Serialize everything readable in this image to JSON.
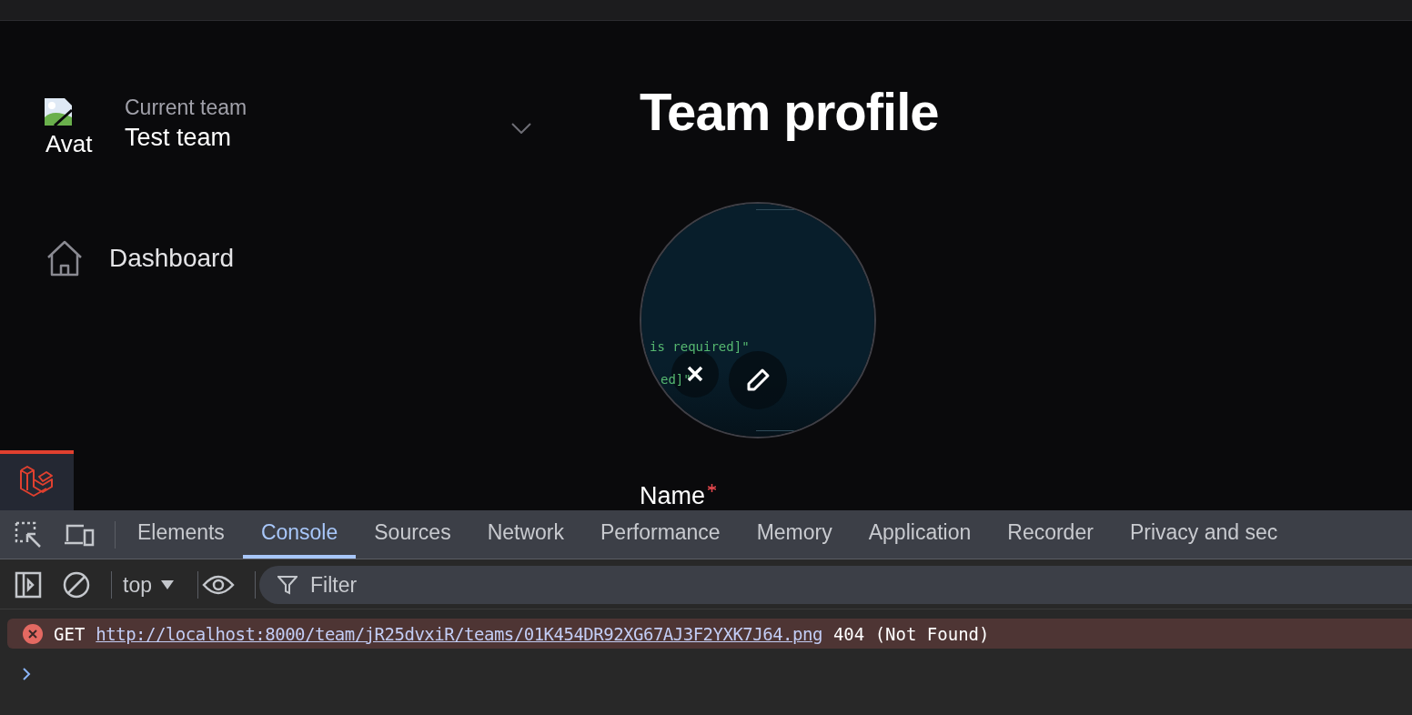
{
  "sidebar": {
    "team_switcher": {
      "avatar_alt": "Avat",
      "label": "Current team",
      "team_name": "Test team"
    },
    "nav_items": [
      {
        "label": "Dashboard",
        "selected": false
      }
    ]
  },
  "main": {
    "title": "Team profile",
    "avatar": {
      "image_lines": [
        "is required]\"",
        "ed]\""
      ]
    },
    "fields": [
      {
        "label": "Name",
        "required": true
      }
    ]
  },
  "devtools": {
    "tabs": [
      {
        "label": "Elements",
        "selected": false
      },
      {
        "label": "Console",
        "selected": true
      },
      {
        "label": "Sources",
        "selected": false
      },
      {
        "label": "Network",
        "selected": false
      },
      {
        "label": "Performance",
        "selected": false
      },
      {
        "label": "Memory",
        "selected": false
      },
      {
        "label": "Application",
        "selected": false
      },
      {
        "label": "Recorder",
        "selected": false
      },
      {
        "label": "Privacy and sec",
        "selected": false
      }
    ],
    "context": "top",
    "filter": {
      "placeholder": "Filter"
    },
    "messages": [
      {
        "kind": "error",
        "method": "GET",
        "url": "http://localhost:8000/team/jR25dvxiR/teams/01K454DR92XG67AJ3F2YXK7J64.png",
        "status": "404 (Not Found)"
      }
    ]
  }
}
